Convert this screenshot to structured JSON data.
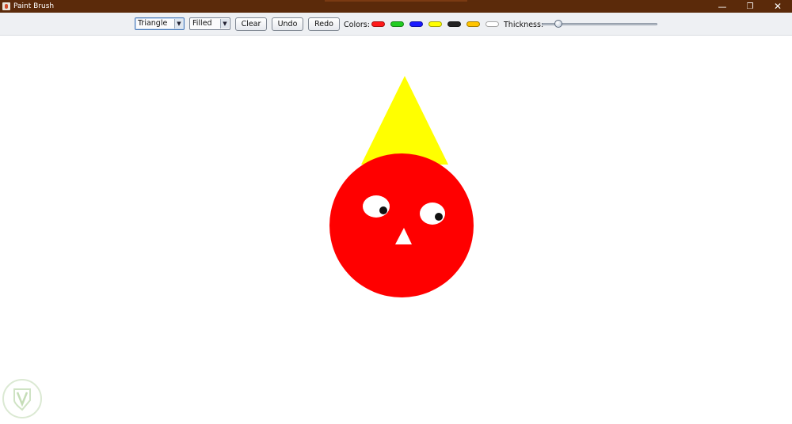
{
  "window": {
    "title": "Paint Brush",
    "minimize_symbol": "—",
    "maximize_symbol": "❐",
    "close_symbol": "✕"
  },
  "toolbar": {
    "shape_select": {
      "value": "Triangle"
    },
    "fill_select": {
      "value": "Filled"
    },
    "clear_label": "Clear",
    "undo_label": "Undo",
    "redo_label": "Redo",
    "colors_label": "Colors:",
    "colors": [
      {
        "name": "red",
        "hex": "#ff1a1a"
      },
      {
        "name": "green",
        "hex": "#22cc22"
      },
      {
        "name": "blue",
        "hex": "#1a1aff"
      },
      {
        "name": "yellow",
        "hex": "#ffff00"
      },
      {
        "name": "black",
        "hex": "#222222"
      },
      {
        "name": "orange",
        "hex": "#ffc400"
      },
      {
        "name": "white",
        "hex": "#ffffff"
      }
    ],
    "thickness_label": "Thickness:",
    "thickness_fraction": 0.12
  },
  "drawing": {
    "shapes": [
      {
        "kind": "triangle",
        "fill": "#ffff00"
      },
      {
        "kind": "circle",
        "fill": "#ff0000"
      },
      {
        "kind": "ellipse",
        "fill": "#ffffff"
      },
      {
        "kind": "circle",
        "fill": "#111111"
      },
      {
        "kind": "ellipse",
        "fill": "#ffffff"
      },
      {
        "kind": "circle",
        "fill": "#111111"
      },
      {
        "kind": "triangle",
        "fill": "#ffffff"
      }
    ]
  },
  "watermark": {
    "icon": "shield-leaf-icon"
  }
}
